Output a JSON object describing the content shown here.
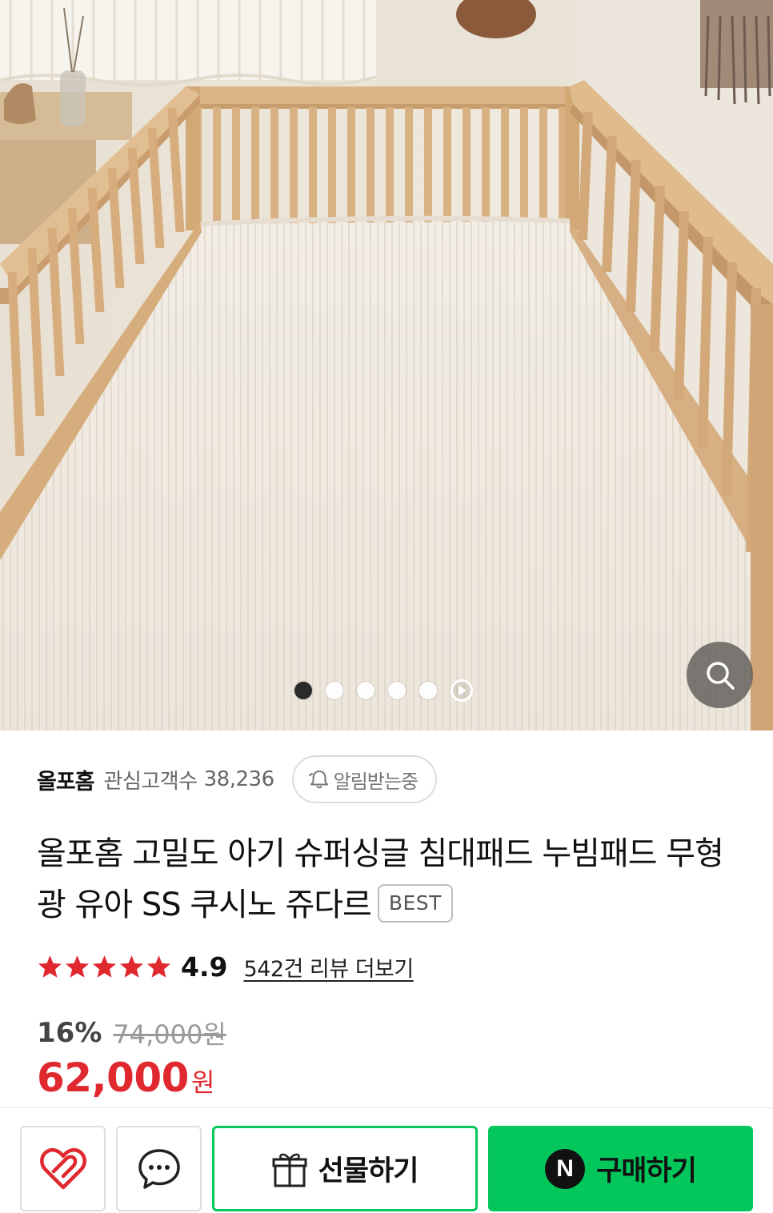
{
  "product_image": {
    "alt": "",
    "pagination": {
      "total": 5,
      "active_index": 0,
      "has_video": true
    }
  },
  "store": {
    "name": "올포홈",
    "fans_label": "관심고객수",
    "fans_count": "38,236",
    "alert_button": "알림받는중"
  },
  "product": {
    "title": "올포홈 고밀도 아기 슈퍼싱글 침대패드 누빔패드 무형광 유아 SS 쿠시노 쥬다르",
    "badge": "BEST",
    "rating": "4.9",
    "rating_value": 4.9,
    "review_link": "542건 리뷰 더보기"
  },
  "pricing": {
    "discount": "16%",
    "original_price": "74,000원",
    "sale_price": "62,000",
    "currency": "원"
  },
  "bottom_bar": {
    "gift_label": "선물하기",
    "buy_label": "구매하기",
    "pay_logo": "N"
  },
  "colors": {
    "price_red": "#e0282f",
    "naver_green": "#03c75a",
    "star_red": "#e0282f"
  },
  "icons": [
    "heart-icon",
    "chat-icon",
    "gift-icon",
    "naver-pay-icon",
    "bell-icon",
    "zoom-icon",
    "play-icon",
    "star-icon"
  ]
}
